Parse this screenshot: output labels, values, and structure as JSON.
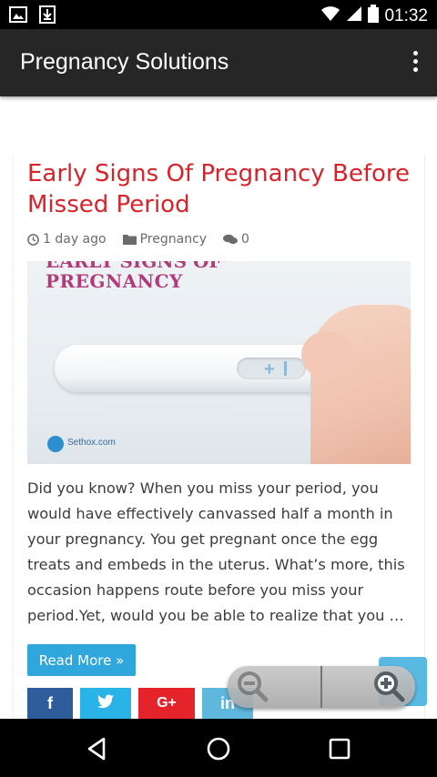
{
  "status_bar": {
    "time": "01:32",
    "icons": [
      "image-notification-icon",
      "download-notification-icon",
      "wifi-icon",
      "signal-icon",
      "battery-icon"
    ]
  },
  "app_bar": {
    "title": "Pregnancy Solutions",
    "menu_icon": "overflow-menu-icon"
  },
  "post": {
    "title": "Early Signs Of Pregnancy Before Missed Period",
    "meta": {
      "time_ago": "1 day ago",
      "category": "Pregnancy",
      "comments": "0"
    },
    "image": {
      "heading_top": "EARLY SIGNS OF",
      "heading": "PREGNANCY",
      "logo_text": "Sethox.com"
    },
    "excerpt": "Did you know? When you miss your period, you would have effectively canvassed half a month in your pregnancy. You get pregnant once the egg treats and embeds in the uterus. What’s more, this occasion happens route before you miss your period.Yet, would you be able to realize that you …",
    "read_more_label": "Read More »"
  },
  "share": {
    "facebook": "f",
    "twitter": "twitter-bird-icon",
    "google_plus": "G+",
    "linkedin": "in"
  },
  "colors": {
    "title_red": "#d9232b",
    "app_bar": "#262626",
    "read_more": "#2fa6dc",
    "facebook": "#2f5d9b",
    "twitter": "#29b3e6",
    "google_plus": "#e4242a",
    "linkedin": "#5fb7de"
  },
  "zoom_control": {
    "zoom_out_icon": "zoom-out-icon",
    "zoom_in_icon": "zoom-in-icon"
  },
  "nav_bar": {
    "buttons": [
      "back-icon",
      "home-icon",
      "recents-icon"
    ]
  }
}
